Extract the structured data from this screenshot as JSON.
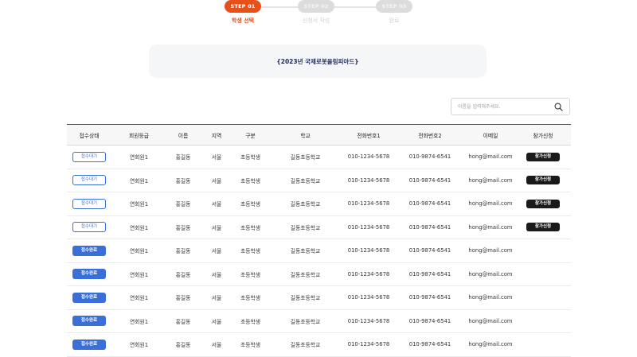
{
  "stepper": {
    "steps": [
      {
        "badge": "STEP 01",
        "label": "학생 선택",
        "state": "active"
      },
      {
        "badge": "STEP 02",
        "label": "신청서 작성",
        "state": "inactive"
      },
      {
        "badge": "STEP 03",
        "label": "완료",
        "state": "inactive"
      }
    ]
  },
  "title": "{2023년 국제로봇올림피아드}",
  "search": {
    "placeholder": "이름을 입력해주세요.",
    "value": "",
    "icon": "search-icon"
  },
  "table": {
    "headers": [
      "접수상태",
      "회원등급",
      "이름",
      "지역",
      "구분",
      "학교",
      "전화번호1",
      "전화번호2",
      "이메일",
      "참가신청"
    ],
    "rows": [
      {
        "status": "접수대기",
        "status_type": "wait",
        "grade": "연회원1",
        "name": "홍길동",
        "region": "서울",
        "category": "초등학생",
        "school": "길동초등학교",
        "phone1": "010-1234-5678",
        "phone2": "010-9874-6541",
        "email": "hong@mail.com",
        "apply": "참가신청"
      },
      {
        "status": "접수대기",
        "status_type": "wait",
        "grade": "연회원1",
        "name": "홍길동",
        "region": "서울",
        "category": "초등학생",
        "school": "길동초등학교",
        "phone1": "010-1234-5678",
        "phone2": "010-9874-6541",
        "email": "hong@mail.com",
        "apply": "참가신청"
      },
      {
        "status": "접수대기",
        "status_type": "wait",
        "grade": "연회원1",
        "name": "홍길동",
        "region": "서울",
        "category": "초등학생",
        "school": "길동초등학교",
        "phone1": "010-1234-5678",
        "phone2": "010-9874-6541",
        "email": "hong@mail.com",
        "apply": "참가신청"
      },
      {
        "status": "접수대기",
        "status_type": "wait",
        "grade": "연회원1",
        "name": "홍길동",
        "region": "서울",
        "category": "초등학생",
        "school": "길동초등학교",
        "phone1": "010-1234-5678",
        "phone2": "010-9874-6541",
        "email": "hong@mail.com",
        "apply": "참가신청"
      },
      {
        "status": "접수완료",
        "status_type": "done",
        "grade": "연회원1",
        "name": "홍길동",
        "region": "서울",
        "category": "초등학생",
        "school": "길동초등학교",
        "phone1": "010-1234-5678",
        "phone2": "010-9874-6541",
        "email": "hong@mail.com",
        "apply": ""
      },
      {
        "status": "접수완료",
        "status_type": "done",
        "grade": "연회원1",
        "name": "홍길동",
        "region": "서울",
        "category": "초등학생",
        "school": "길동초등학교",
        "phone1": "010-1234-5678",
        "phone2": "010-9874-6541",
        "email": "hong@mail.com",
        "apply": ""
      },
      {
        "status": "접수완료",
        "status_type": "done",
        "grade": "연회원1",
        "name": "홍길동",
        "region": "서울",
        "category": "초등학생",
        "school": "길동초등학교",
        "phone1": "010-1234-5678",
        "phone2": "010-9874-6541",
        "email": "hong@mail.com",
        "apply": ""
      },
      {
        "status": "접수완료",
        "status_type": "done",
        "grade": "연회원1",
        "name": "홍길동",
        "region": "서울",
        "category": "초등학생",
        "school": "길동초등학교",
        "phone1": "010-1234-5678",
        "phone2": "010-9874-6541",
        "email": "hong@mail.com",
        "apply": ""
      },
      {
        "status": "접수완료",
        "status_type": "done",
        "grade": "연회원1",
        "name": "홍길동",
        "region": "서울",
        "category": "초등학생",
        "school": "길동초등학교",
        "phone1": "010-1234-5678",
        "phone2": "010-9874-6541",
        "email": "hong@mail.com",
        "apply": ""
      }
    ]
  },
  "colors": {
    "accent": "#e8501a",
    "primary": "#3b6fd8",
    "dark_button": "#1a1a1a",
    "title_text": "#1e2a5a"
  }
}
